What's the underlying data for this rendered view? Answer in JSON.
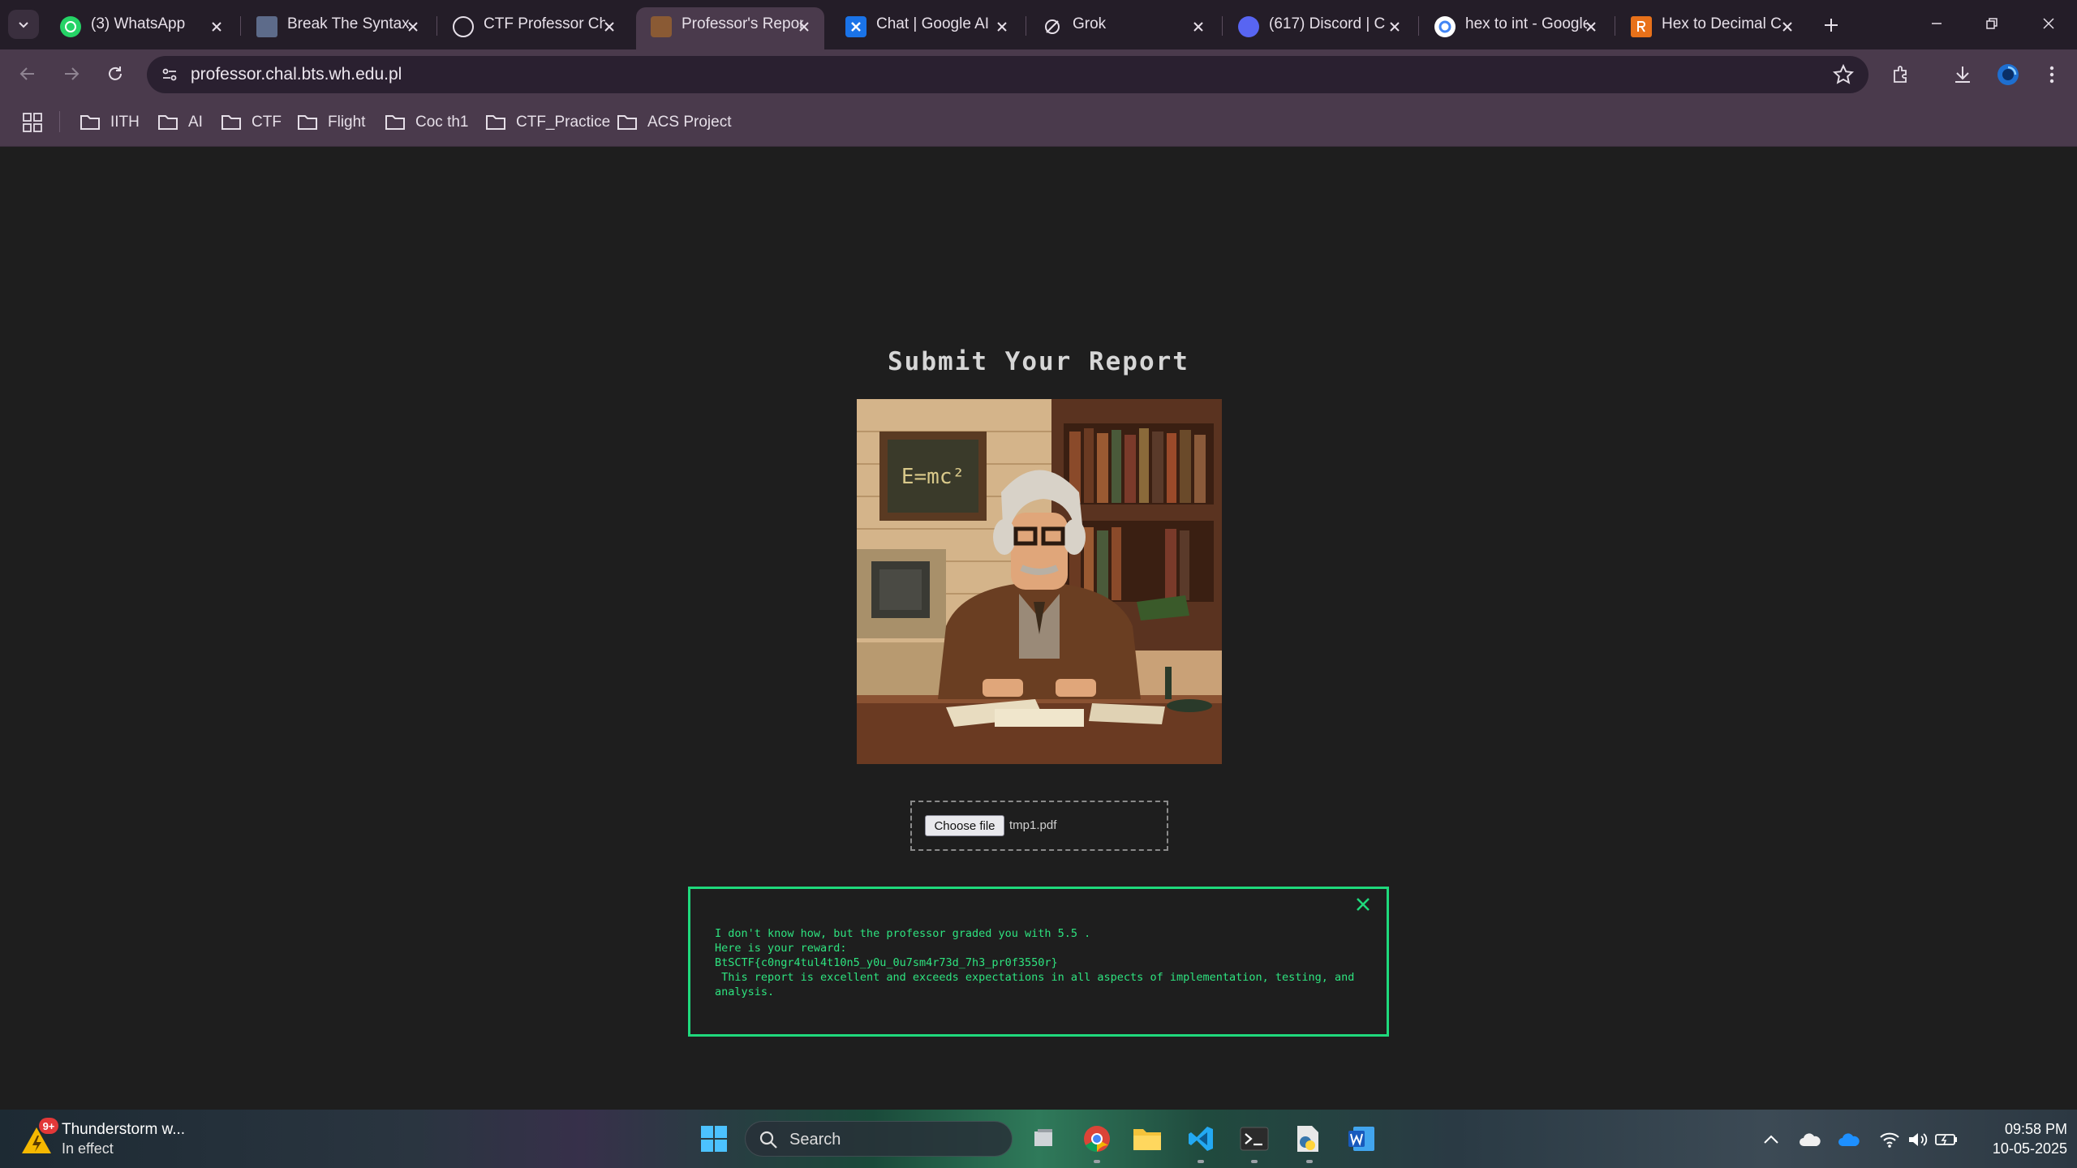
{
  "browser": {
    "tabs": [
      {
        "title": "(3) WhatsApp",
        "favicon": "whatsapp-icon",
        "active": false
      },
      {
        "title": "Break The Syntax",
        "favicon": "bts-icon",
        "active": false
      },
      {
        "title": "CTF Professor Challenge",
        "favicon": "chatgpt-icon",
        "active": false
      },
      {
        "title": "Professor's Report",
        "favicon": "professor-icon",
        "active": true
      },
      {
        "title": "Chat | Google AI",
        "favicon": "google-ai-icon",
        "active": false
      },
      {
        "title": "Grok",
        "favicon": "grok-icon",
        "active": false
      },
      {
        "title": "(617) Discord | C",
        "favicon": "discord-icon",
        "active": false
      },
      {
        "title": "hex to int - Google",
        "favicon": "google-icon",
        "active": false
      },
      {
        "title": "Hex to Decimal C",
        "favicon": "rapidtables-icon",
        "active": false
      }
    ],
    "url": "professor.chal.bts.wh.edu.pl",
    "bookmarks": [
      "IITH",
      "AI",
      "CTF",
      "Flight",
      "Coc th1",
      "CTF_Practice",
      "ACS Project"
    ],
    "colors": {
      "tabstrip": "#241d28",
      "toolbar": "#4a3a4c",
      "active_tab": "#4a3a4c"
    }
  },
  "page": {
    "title": "Submit Your Report",
    "portrait_alt": "E=mc²",
    "file_input": {
      "button_label": "Choose file",
      "file_name": "tmp1.pdf"
    },
    "result": {
      "line1": "I don't know how, but the professor graded you with 5.5 .",
      "line2": "Here is your reward:",
      "line3": "BtSCTF{c0ngr4tul4t10n5_y0u_0u7sm4r73d_7h3_pr0f3550r}",
      "line4": " This report is excellent and exceeds expectations in all aspects of implementation, testing, and analysis.",
      "accent": "#1fd97c"
    }
  },
  "taskbar": {
    "weather_title": "Thunderstorm w...",
    "weather_sub": "In effect",
    "weather_badge": "9+",
    "search_label": "Search",
    "time": "09:58 PM",
    "date": "10-05-2025"
  }
}
